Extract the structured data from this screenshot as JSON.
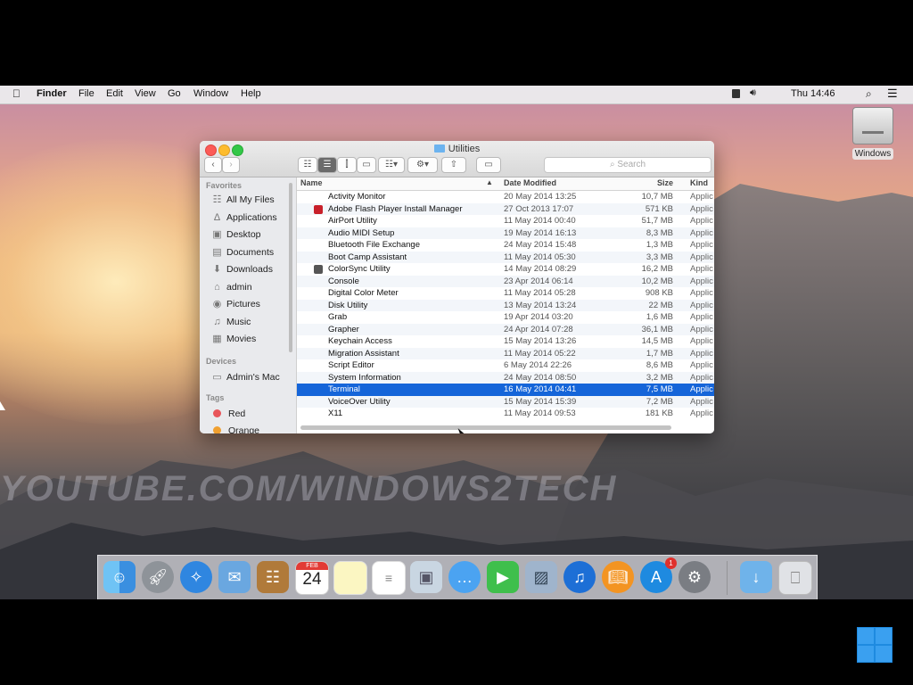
{
  "menubar": {
    "app": "Finder",
    "menus": [
      "File",
      "Edit",
      "View",
      "Go",
      "Window",
      "Help"
    ],
    "clock": "Thu 14:46"
  },
  "desktop": {
    "drive_label": "Windows",
    "watermark": "YOUTUBE.COM/WINDOWS2TECH"
  },
  "window": {
    "title": "Utilities",
    "search_placeholder": "Search",
    "columns": {
      "name": "Name",
      "date": "Date Modified",
      "size": "Size",
      "kind": "Kind"
    }
  },
  "sidebar": {
    "favorites_header": "Favorites",
    "favorites": [
      {
        "label": "All My Files",
        "icon": "all-files-icon"
      },
      {
        "label": "Applications",
        "icon": "applications-icon"
      },
      {
        "label": "Desktop",
        "icon": "desktop-icon"
      },
      {
        "label": "Documents",
        "icon": "documents-icon"
      },
      {
        "label": "Downloads",
        "icon": "downloads-icon"
      },
      {
        "label": "admin",
        "icon": "home-icon"
      },
      {
        "label": "Pictures",
        "icon": "camera-icon"
      },
      {
        "label": "Music",
        "icon": "music-note-icon"
      },
      {
        "label": "Movies",
        "icon": "film-icon"
      }
    ],
    "devices_header": "Devices",
    "devices": [
      {
        "label": "Admin's Mac",
        "icon": "computer-icon"
      }
    ],
    "tags_header": "Tags",
    "tags": [
      {
        "label": "Red",
        "color": "#e8555a"
      },
      {
        "label": "Orange",
        "color": "#f0a030"
      }
    ]
  },
  "files": [
    {
      "name": "Activity Monitor",
      "date": "20 May 2014 13:25",
      "size": "10,7 MB",
      "kind": "Applic"
    },
    {
      "name": "Adobe Flash Player Install Manager",
      "date": "27 Oct 2013 17:07",
      "size": "571 KB",
      "kind": "Applic"
    },
    {
      "name": "AirPort Utility",
      "date": "11 May 2014 00:40",
      "size": "51,7 MB",
      "kind": "Applic"
    },
    {
      "name": "Audio MIDI Setup",
      "date": "19 May 2014 16:13",
      "size": "8,3 MB",
      "kind": "Applic"
    },
    {
      "name": "Bluetooth File Exchange",
      "date": "24 May 2014 15:48",
      "size": "1,3 MB",
      "kind": "Applic"
    },
    {
      "name": "Boot Camp Assistant",
      "date": "11 May 2014 05:30",
      "size": "3,3 MB",
      "kind": "Applic"
    },
    {
      "name": "ColorSync Utility",
      "date": "14 May 2014 08:29",
      "size": "16,2 MB",
      "kind": "Applic"
    },
    {
      "name": "Console",
      "date": "23 Apr 2014 06:14",
      "size": "10,2 MB",
      "kind": "Applic"
    },
    {
      "name": "Digital Color Meter",
      "date": "11 May 2014 05:28",
      "size": "908 KB",
      "kind": "Applic"
    },
    {
      "name": "Disk Utility",
      "date": "13 May 2014 13:24",
      "size": "22 MB",
      "kind": "Applic"
    },
    {
      "name": "Grab",
      "date": "19 Apr 2014 03:20",
      "size": "1,6 MB",
      "kind": "Applic"
    },
    {
      "name": "Grapher",
      "date": "24 Apr 2014 07:28",
      "size": "36,1 MB",
      "kind": "Applic"
    },
    {
      "name": "Keychain Access",
      "date": "15 May 2014 13:26",
      "size": "14,5 MB",
      "kind": "Applic"
    },
    {
      "name": "Migration Assistant",
      "date": "11 May 2014 05:22",
      "size": "1,7 MB",
      "kind": "Applic"
    },
    {
      "name": "Script Editor",
      "date": "6 May 2014 22:26",
      "size": "8,6 MB",
      "kind": "Applic"
    },
    {
      "name": "System Information",
      "date": "24 May 2014 08:50",
      "size": "3,2 MB",
      "kind": "Applic"
    },
    {
      "name": "Terminal",
      "date": "16 May 2014 04:41",
      "size": "7,5 MB",
      "kind": "Applic",
      "selected": true
    },
    {
      "name": "VoiceOver Utility",
      "date": "15 May 2014 15:39",
      "size": "7,2 MB",
      "kind": "Applic"
    },
    {
      "name": "X11",
      "date": "11 May 2014 09:53",
      "size": "181 KB",
      "kind": "Applic"
    }
  ],
  "dock": {
    "calendar_month": "FEB",
    "calendar_day": "24",
    "app_store_badge": "1",
    "items": [
      "finder-icon",
      "launchpad-icon",
      "safari-icon",
      "mail-icon",
      "contacts-icon",
      "calendar-icon",
      "notes-icon",
      "reminders-icon",
      "photo-booth-icon",
      "messages-icon",
      "facetime-icon",
      "preview-icon",
      "itunes-icon",
      "ibooks-icon",
      "app-store-icon",
      "system-preferences-icon",
      "downloads-folder-icon",
      "trash-icon"
    ]
  },
  "colors": {
    "selection": "#1565d9",
    "accent_blue": "#1e8ae0"
  }
}
